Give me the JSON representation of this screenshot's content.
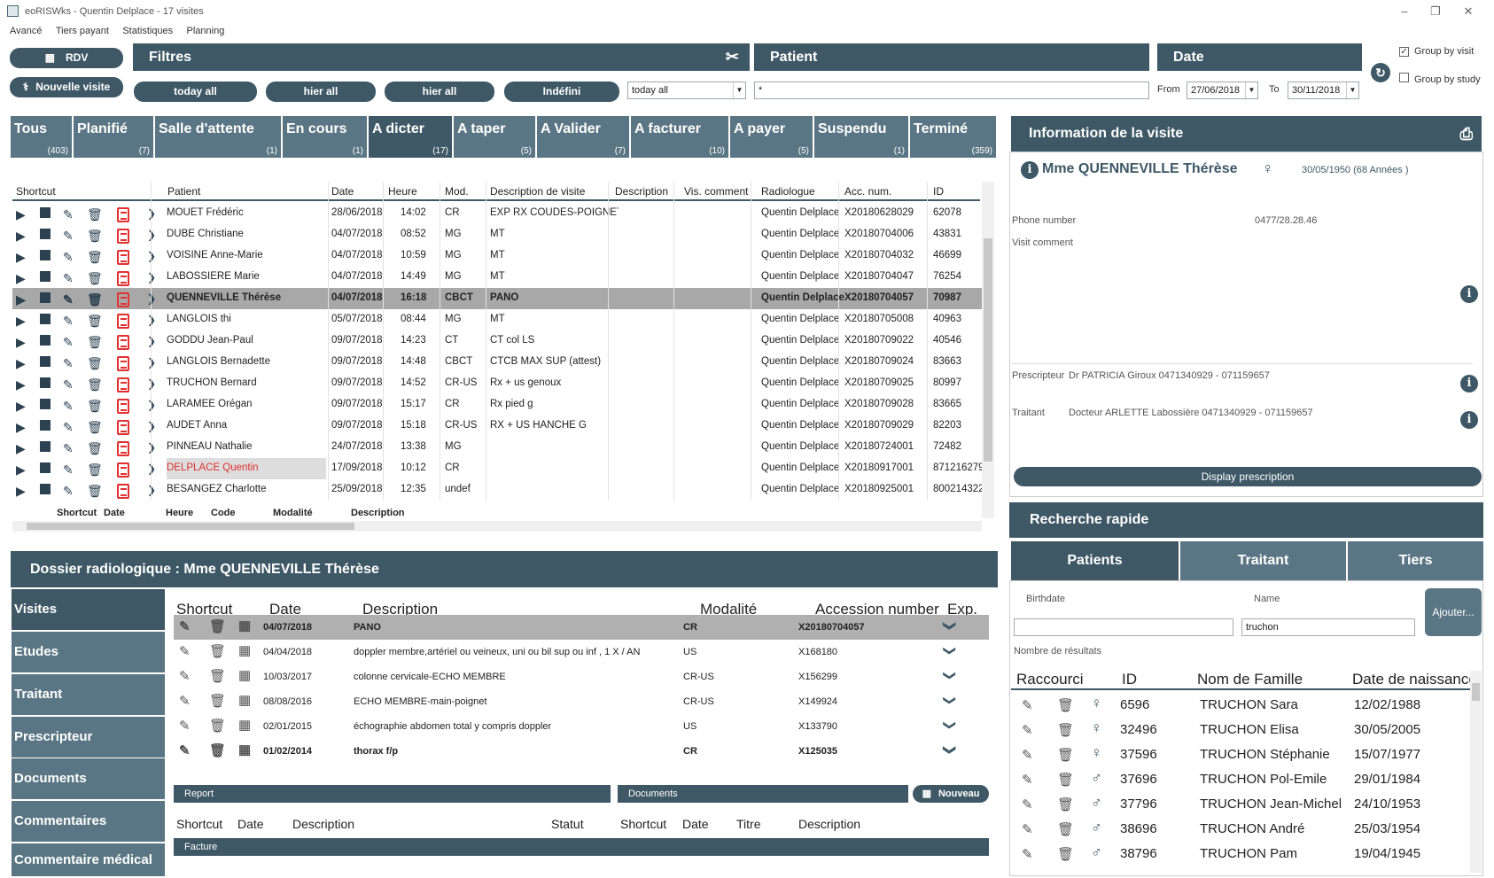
{
  "window": {
    "title": "eoRISWks - Quentin Delplace - 17 visites"
  },
  "menu": [
    "Avancé",
    "Tiers payant",
    "Statistiques",
    "Planning"
  ],
  "toolbar": {
    "rdv": "RDV",
    "nouvelle_visite": "Nouvelle visite"
  },
  "filters": {
    "title": "Filtres",
    "buttons": [
      "today all",
      "hier all",
      "hier all",
      "Indéfini"
    ],
    "combo_value": "today all"
  },
  "patient": {
    "title": "Patient",
    "search_value": "*"
  },
  "date": {
    "title": "Date",
    "from_label": "From",
    "from_value": "27/06/2018",
    "to_label": "To",
    "to_value": "30/11/2018"
  },
  "grouping": {
    "group_by_visit": "Group by visit",
    "group_by_study": "Group by study"
  },
  "status_tabs": [
    {
      "label": "Tous",
      "count": "(403)"
    },
    {
      "label": "Planifié",
      "count": "(7)"
    },
    {
      "label": "Salle d'attente",
      "count": "(1)"
    },
    {
      "label": "En cours",
      "count": "(1)"
    },
    {
      "label": "A dicter",
      "count": "(17)"
    },
    {
      "label": "A taper",
      "count": "(5)"
    },
    {
      "label": "A Valider",
      "count": "(7)"
    },
    {
      "label": "A facturer",
      "count": "(10)"
    },
    {
      "label": "A payer",
      "count": "(5)"
    },
    {
      "label": "Suspendu",
      "count": "(1)"
    },
    {
      "label": "Terminé",
      "count": "(359)"
    }
  ],
  "grid": {
    "headers": [
      "Shortcut",
      "Patient",
      "Date",
      "Heure",
      "Mod.",
      "Description de visite",
      "Description",
      "Vis. comment",
      "Radiologue",
      "Acc. num.",
      "ID"
    ],
    "rows": [
      [
        "MOUET Frédéric",
        "28/06/2018",
        "14:02",
        "CR",
        "EXP RX COUDES-POIGNETS",
        "Quentin Delplace",
        "X20180628029",
        "62078"
      ],
      [
        "DUBÉ Christiane",
        "04/07/2018",
        "08:52",
        "MG",
        "MT",
        "Quentin Delplace",
        "X20180704006",
        "43831"
      ],
      [
        "VOISINE Anne-Marie",
        "04/07/2018",
        "10:59",
        "MG",
        "MT",
        "Quentin Delplace",
        "X20180704032",
        "46699"
      ],
      [
        "LABOSSIÈRE Marie",
        "04/07/2018",
        "14:49",
        "MG",
        "MT",
        "Quentin Delplace",
        "X20180704047",
        "76254"
      ],
      [
        "QUENNEVILLE Thérèse",
        "04/07/2018",
        "16:18",
        "CBCT",
        "PANO",
        "Quentin Delplace",
        "X20180704057",
        "70987"
      ],
      [
        "LANGLOIS thi",
        "05/07/2018",
        "08:44",
        "MG",
        "MT",
        "Quentin Delplace",
        "X20180705008",
        "40963"
      ],
      [
        "GODDU Jean-Paul",
        "09/07/2018",
        "14:23",
        "CT",
        "CT col LS",
        "Quentin Delplace",
        "X20180709022",
        "40546"
      ],
      [
        "LANGLOIS Bernadette",
        "09/07/2018",
        "14:48",
        "CBCT",
        "CTCB MAX SUP (attest)",
        "Quentin Delplace",
        "X20180709024",
        "83663"
      ],
      [
        "TRUCHON Bernard",
        "09/07/2018",
        "14:52",
        "CR-US",
        "Rx + us genoux",
        "Quentin Delplace",
        "X20180709025",
        "80997"
      ],
      [
        "LARAMÉE Orégan",
        "09/07/2018",
        "15:17",
        "CR",
        "Rx pied g",
        "Quentin Delplace",
        "X20180709028",
        "83665"
      ],
      [
        "AUDET Anna",
        "09/07/2018",
        "15:18",
        "CR-US",
        "RX + US HANCHE G",
        "Quentin Delplace",
        "X20180709029",
        "82203"
      ],
      [
        "PINNEAU Nathalie",
        "24/07/2018",
        "13:38",
        "MG",
        "",
        "Quentin Delplace",
        "X20180724001",
        "72482"
      ],
      [
        "DELPLACE Quentin",
        "17/09/2018",
        "10:12",
        "CR",
        "",
        "Quentin Delplace",
        "X20180917001",
        "871216279"
      ],
      [
        "BESANGEZ Charlotte",
        "25/09/2018",
        "12:35",
        "undef",
        "",
        "Quentin Delplace",
        "X20180925001",
        "800214322"
      ]
    ],
    "footer_headers": [
      "Shortcut",
      "Date",
      "Heure",
      "Code",
      "Modalité",
      "Description"
    ]
  },
  "dossier": {
    "title": "Dossier radiologique : Mme QUENNEVILLE Thérèse",
    "side": [
      "Visites",
      "Etudes",
      "Traitant",
      "Prescripteur",
      "Documents",
      "Commentaires",
      "Commentaire médical"
    ],
    "headers": [
      "Shortcut",
      "Date",
      "Description",
      "Modalité",
      "Accession number",
      "Exp."
    ],
    "rows": [
      [
        "04/07/2018",
        "PANO",
        "CR",
        "X20180704057"
      ],
      [
        "04/04/2018",
        "doppler membre,artériel ou veineux, uni ou bil  sup ou inf , 1 X / AN",
        "US",
        "X168180"
      ],
      [
        "10/03/2017",
        "colonne cervicale-ECHO MEMBRE",
        "CR-US",
        "X156299"
      ],
      [
        "08/08/2016",
        "ECHO MEMBRE-main-poignet",
        "CR-US",
        "X149924"
      ],
      [
        "02/01/2015",
        "échographie abdomen total y compris doppler",
        "US",
        "X133790"
      ],
      [
        "01/02/2014",
        "thorax f/p",
        "CR",
        "X125035"
      ]
    ],
    "report_label": "Report",
    "documents_label": "Documents",
    "nouveau_label": "Nouveau",
    "report_headers": [
      "Shortcut",
      "Date",
      "Description",
      "Statut"
    ],
    "doc_headers": [
      "Shortcut",
      "Date",
      "Titre",
      "Description"
    ],
    "facture_label": "Facture"
  },
  "info": {
    "title": "Information de la visite",
    "patient_name": "Mme QUENNEVILLE Thérèse",
    "dob": "30/05/1950 (68 Années )",
    "phone_label": "Phone number",
    "phone_value": "0477/28.28.46",
    "visit_comment_label": "Visit comment",
    "prescripteur_label": "Prescripteur",
    "prescripteur_value": "Dr PATRICIA Giroux   0471340929 - 071159657",
    "traitant_label": "Traitant",
    "traitant_value": "Docteur ARLETTE Labossière   0471340929 - 071159657",
    "display_prescription": "Display prescription"
  },
  "quick_search": {
    "title": "Recherche rapide",
    "tabs": [
      "Patients",
      "Traitant",
      "Tiers"
    ],
    "birthdate_label": "Birthdate",
    "name_label": "Name",
    "name_value": "truchon",
    "ajouter": "Ajouter...",
    "results_label": "Nombre de résultats",
    "headers": [
      "Raccourci",
      "ID",
      "Nom de Famille",
      "Date de naissance"
    ],
    "rows": [
      [
        "6596",
        "TRUCHON Sara",
        "12/02/1988",
        "f"
      ],
      [
        "32496",
        "TRUCHON Elisa",
        "30/05/2005",
        "f"
      ],
      [
        "37596",
        "TRUCHON Stéphanie",
        "15/07/1977",
        "f"
      ],
      [
        "37696",
        "TRUCHON Pol-Emile",
        "29/01/1984",
        "m"
      ],
      [
        "37796",
        "TRUCHON Jean-Michel",
        "24/10/1953",
        "m"
      ],
      [
        "38696",
        "TRUCHON André",
        "25/03/1954",
        "m"
      ],
      [
        "38796",
        "TRUCHON Pam",
        "19/04/1945",
        "m"
      ]
    ]
  },
  "colors": {
    "primary": "#3e5866",
    "secondary": "#5a7684",
    "alert": "#e03030"
  }
}
